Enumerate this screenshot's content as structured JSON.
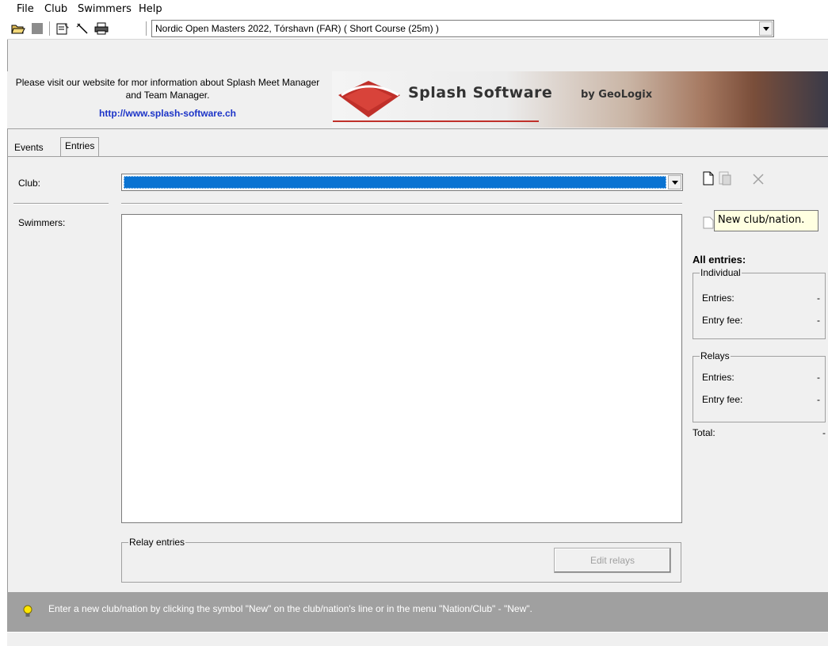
{
  "menu": [
    "File",
    "Club",
    "Swimmers",
    "Help"
  ],
  "toolbar": {
    "meet_selector_value": "Nordic Open Masters 2022,  Tórshavn  (FAR)   ( Short Course (25m) )",
    "icons": [
      "open-folder-icon",
      "stop-icon",
      "properties-icon",
      "wand-icon",
      "print-icon"
    ]
  },
  "banner": {
    "text": "Please visit our website for mor information about Splash Meet Manager and Team Manager.",
    "link": "http://www.splash-software.ch",
    "logo_title": "Splash Software",
    "logo_by": "by GeoLogix",
    "logo_color": "#c0302a"
  },
  "tabs": [
    {
      "label": "Events",
      "active": false
    },
    {
      "label": "Entries",
      "active": true
    }
  ],
  "form": {
    "club_label": "Club:",
    "club_value": "",
    "swimmers_label": "Swimmers:",
    "relay_group_title": "Relay entries",
    "edit_relays_label": "Edit relays"
  },
  "tooltip": "New club/nation.",
  "summary": {
    "title": "All entries:",
    "individual": {
      "title": "Individual",
      "entries_label": "Entries:",
      "entries_value": "-",
      "fee_label": "Entry fee:",
      "fee_value": "-"
    },
    "relays": {
      "title": "Relays",
      "entries_label": "Entries:",
      "entries_value": "-",
      "fee_label": "Entry fee:",
      "fee_value": "-"
    },
    "total_label": "Total:",
    "total_value": "-"
  },
  "status": {
    "text": "Enter a new club/nation by clicking the symbol \"New\" on the club/nation's line or in the menu \"Nation/Club\" - \"New\".",
    "bg_color": "#a0a0a0"
  },
  "colors": {
    "selection": "#0a73d2",
    "link": "#1c34c8"
  }
}
